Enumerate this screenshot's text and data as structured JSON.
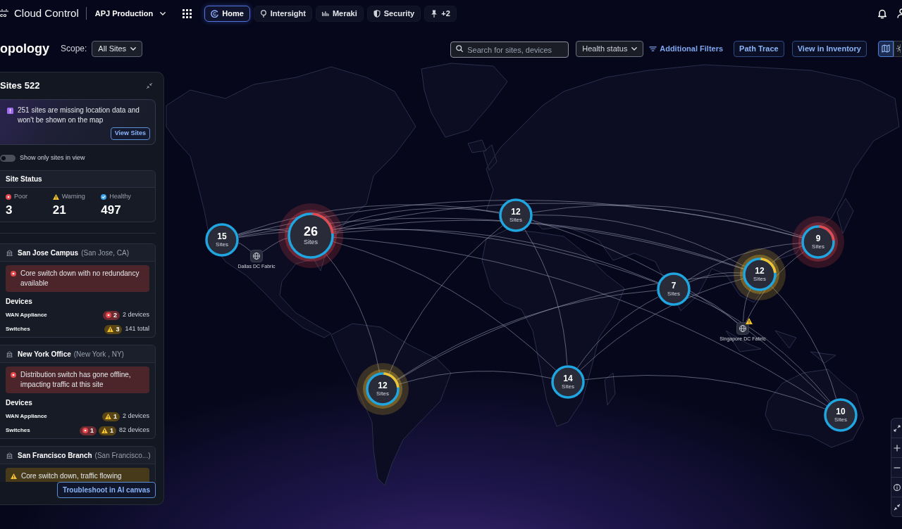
{
  "top_bar": {
    "logo_text": "co",
    "app_name": "Cloud Control",
    "workspace": "APJ Production",
    "tabs": [
      {
        "label": "Home",
        "selected": true
      },
      {
        "label": "Intersight",
        "selected": false
      },
      {
        "label": "Meraki",
        "selected": false
      },
      {
        "label": "Security",
        "selected": false
      },
      {
        "label": "+2",
        "selected": false
      }
    ]
  },
  "page_header": {
    "title": "opology",
    "scope_label": "Scope:",
    "scope_value": "All Sites"
  },
  "toolbar": {
    "search": {
      "placeholder": "Search for sites, devices"
    },
    "health_filter": "Health status",
    "filters_link": "Additional Filters",
    "buttons": [
      "Path Trace",
      "View in Inventory"
    ],
    "view_modes": [
      {
        "selected": true
      },
      {
        "selected": false
      }
    ]
  },
  "sidebar": {
    "title": "Sites 522",
    "notice": {
      "text": "251 sites are missing location data and won't be shown on the map",
      "button": "View Sites"
    },
    "toggle": {
      "label": "Show only sites in view",
      "on": false
    },
    "site_status": {
      "title": "Site Status",
      "items": [
        {
          "kind": "poor",
          "label": "Poor",
          "value": "3"
        },
        {
          "kind": "warning",
          "label": "Warning",
          "value": "21"
        },
        {
          "kind": "healthy",
          "label": "Healthy",
          "value": "497"
        }
      ]
    },
    "sites": [
      {
        "name": "San Jose Campus",
        "location": "(San Jose, CA)",
        "alert": {
          "kind": "critical",
          "text": "Core switch down with no redundancy available"
        },
        "devices_title": "Devices",
        "devices": [
          {
            "name": "WAN Appliance",
            "badges": [
              {
                "kind": "critical",
                "count": "2"
              }
            ],
            "summary": "2 devices"
          },
          {
            "name": "Switches",
            "badges": [
              {
                "kind": "warning",
                "count": "3"
              }
            ],
            "summary": "141 total"
          }
        ]
      },
      {
        "name": "New York Office",
        "location": "(New York , NY)",
        "alert": {
          "kind": "critical",
          "text": "Distribution switch has gone offline, impacting traffic at this site"
        },
        "devices_title": "Devices",
        "devices": [
          {
            "name": "WAN Appliance",
            "badges": [
              {
                "kind": "warning",
                "count": "1"
              }
            ],
            "summary": "2 devices"
          },
          {
            "name": "Switches",
            "badges": [
              {
                "kind": "critical",
                "count": "1"
              },
              {
                "kind": "warning",
                "count": "1"
              }
            ],
            "summary": "82 devices"
          }
        ]
      },
      {
        "name": "San Francisco Branch",
        "location": "(San Francisco...)",
        "alert": {
          "kind": "warning",
          "text": "Core switch down, traffic flowing"
        }
      }
    ],
    "footer_button": "Troubleshoot in AI canvas"
  },
  "map": {
    "clusters": [
      {
        "count": "15",
        "label": "Sites",
        "kind": "standard"
      },
      {
        "count": "26",
        "label": "Sites",
        "kind": "large",
        "color": "#e5484d"
      },
      {
        "count": "12",
        "label": "Sites",
        "kind": "standard"
      },
      {
        "count": "9",
        "label": "Sites",
        "kind": "standard",
        "color": "#e5484d"
      },
      {
        "count": "12",
        "label": "Sites",
        "kind": "standard",
        "color": "#f2c230"
      },
      {
        "count": "7",
        "label": "Sites",
        "kind": "standard"
      },
      {
        "count": "12",
        "label": "Sites",
        "kind": "standard",
        "color": "#f2c230"
      },
      {
        "count": "14",
        "label": "Sites",
        "kind": "standard"
      },
      {
        "count": "10",
        "label": "Sites",
        "kind": "standard"
      }
    ],
    "fabrics": [
      {
        "label": "Dallas DC Fabric",
        "warning": false
      },
      {
        "label": "Singapore DC Fabric",
        "warning": true
      }
    ]
  }
}
